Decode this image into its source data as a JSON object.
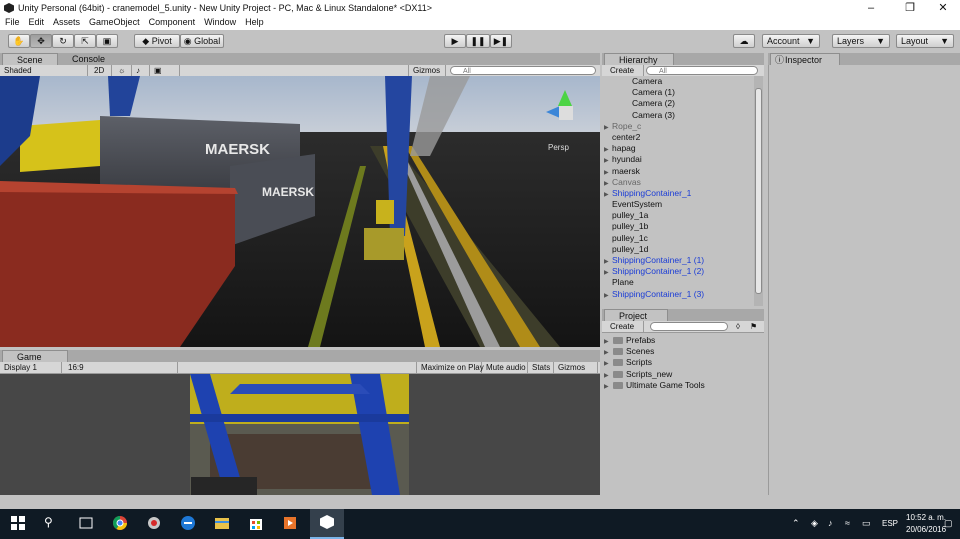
{
  "window": {
    "title": "Unity Personal (64bit) - cranemodel_5.unity - New Unity Project - PC, Mac & Linux Standalone* <DX11>"
  },
  "menu": [
    "File",
    "Edit",
    "Assets",
    "GameObject",
    "Component",
    "Window",
    "Help"
  ],
  "toolbar": {
    "pivot": "Pivot",
    "global": "Global",
    "account": "Account",
    "layers": "Layers",
    "layout": "Layout"
  },
  "scene": {
    "tabs": [
      "Scene",
      "Console"
    ],
    "shading": "Shaded",
    "mode2d": "2D",
    "gizmos": "Gizmos",
    "search_placeholder": "All",
    "persp": "Persp",
    "container_brand": "MAERSK"
  },
  "game": {
    "tab": "Game",
    "display": "Display 1",
    "aspect": "16:9",
    "maximize": "Maximize on Play",
    "mute": "Mute audio",
    "stats": "Stats",
    "gizmos": "Gizmos"
  },
  "hierarchy": {
    "tab": "Hierarchy",
    "create": "Create",
    "search_placeholder": "All",
    "items": [
      {
        "label": "Camera",
        "indent": 2,
        "style": "normal",
        "arrow": false
      },
      {
        "label": "Camera (1)",
        "indent": 2,
        "style": "normal",
        "arrow": false
      },
      {
        "label": "Camera (2)",
        "indent": 2,
        "style": "normal",
        "arrow": false
      },
      {
        "label": "Camera (3)",
        "indent": 2,
        "style": "normal",
        "arrow": false
      },
      {
        "label": "Rope_c",
        "indent": 0,
        "style": "grey",
        "arrow": true
      },
      {
        "label": "center2",
        "indent": 0,
        "style": "normal",
        "arrow": false
      },
      {
        "label": "hapag",
        "indent": 0,
        "style": "normal",
        "arrow": true
      },
      {
        "label": "hyundai",
        "indent": 0,
        "style": "normal",
        "arrow": true
      },
      {
        "label": "maersk",
        "indent": 0,
        "style": "normal",
        "arrow": true
      },
      {
        "label": "Canvas",
        "indent": 0,
        "style": "grey",
        "arrow": true
      },
      {
        "label": "ShippingContainer_1",
        "indent": 0,
        "style": "blue",
        "arrow": true
      },
      {
        "label": "EventSystem",
        "indent": 0,
        "style": "normal",
        "arrow": false
      },
      {
        "label": "pulley_1a",
        "indent": 0,
        "style": "normal",
        "arrow": false
      },
      {
        "label": "pulley_1b",
        "indent": 0,
        "style": "normal",
        "arrow": false
      },
      {
        "label": "pulley_1c",
        "indent": 0,
        "style": "normal",
        "arrow": false
      },
      {
        "label": "pulley_1d",
        "indent": 0,
        "style": "normal",
        "arrow": false
      },
      {
        "label": "ShippingContainer_1 (1)",
        "indent": 0,
        "style": "blue",
        "arrow": true
      },
      {
        "label": "ShippingContainer_1 (2)",
        "indent": 0,
        "style": "blue",
        "arrow": true
      },
      {
        "label": "Plane",
        "indent": 0,
        "style": "normal",
        "arrow": false
      },
      {
        "label": "ShippingContainer_1 (3)",
        "indent": 0,
        "style": "blue",
        "arrow": true
      }
    ]
  },
  "project": {
    "tab": "Project",
    "create": "Create",
    "folders": [
      "Prefabs",
      "Scenes",
      "Scripts",
      "Scripts_new",
      "Ultimate Game Tools"
    ]
  },
  "inspector": {
    "tab": "Inspector"
  },
  "taskbar": {
    "language": "ESP",
    "time": "10:52 a. m.",
    "date": "20/06/2016"
  }
}
